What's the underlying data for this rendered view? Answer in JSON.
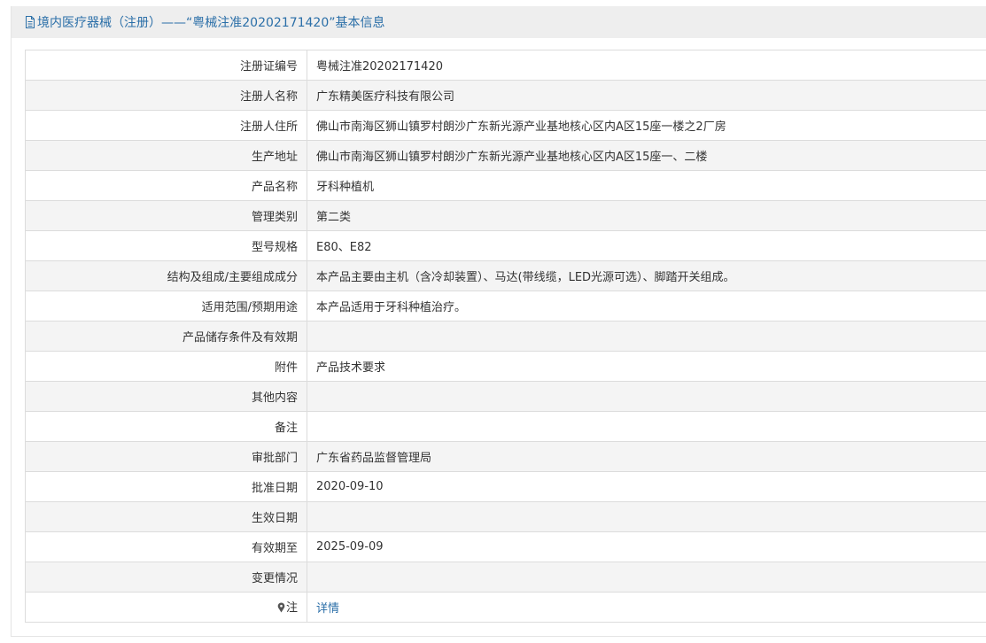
{
  "header": {
    "title": "境内医疗器械（注册）——“粤械注准20202171420”基本信息"
  },
  "rows": [
    {
      "label": "注册证编号",
      "value": "粤械注准20202171420"
    },
    {
      "label": "注册人名称",
      "value": "广东精美医疗科技有限公司"
    },
    {
      "label": "注册人住所",
      "value": "佛山市南海区狮山镇罗村朗沙广东新光源产业基地核心区内A区15座一楼之2厂房"
    },
    {
      "label": "生产地址",
      "value": "佛山市南海区狮山镇罗村朗沙广东新光源产业基地核心区内A区15座一、二楼"
    },
    {
      "label": "产品名称",
      "value": "牙科种植机"
    },
    {
      "label": "管理类别",
      "value": "第二类"
    },
    {
      "label": "型号规格",
      "value": "E80、E82"
    },
    {
      "label": "结构及组成/主要组成成分",
      "value": "本产品主要由主机（含冷却装置）、马达(带线缆，LED光源可选）、脚踏开关组成。"
    },
    {
      "label": "适用范围/预期用途",
      "value": "本产品适用于牙科种植治疗。"
    },
    {
      "label": "产品储存条件及有效期",
      "value": ""
    },
    {
      "label": "附件",
      "value": "产品技术要求"
    },
    {
      "label": "其他内容",
      "value": ""
    },
    {
      "label": "备注",
      "value": ""
    },
    {
      "label": "审批部门",
      "value": "广东省药品监督管理局"
    },
    {
      "label": "批准日期",
      "value": "2020-09-10"
    },
    {
      "label": "生效日期",
      "value": ""
    },
    {
      "label": "有效期至",
      "value": "2025-09-09"
    },
    {
      "label": "变更情况",
      "value": ""
    }
  ],
  "note": {
    "label": "注",
    "link_text": "详情",
    "icon": "map-pin-icon"
  },
  "colors": {
    "accent": "#2b6fa8",
    "header_bg": "#eeeeee",
    "row_alt_bg": "#f4f4f4",
    "border": "#dcdcdc"
  }
}
